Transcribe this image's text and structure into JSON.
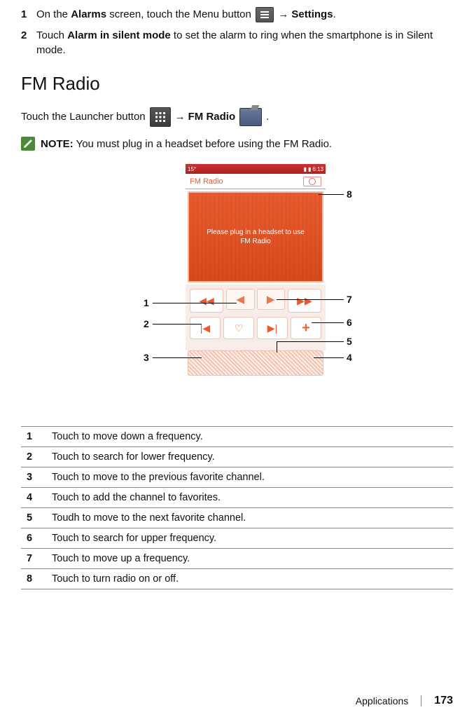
{
  "steps_top": [
    {
      "num": "1",
      "parts": [
        "On the ",
        {
          "b": "Alarms"
        },
        " screen, touch the Menu button ",
        {
          "icon": "menu"
        },
        " → ",
        {
          "b": "Settings"
        },
        "."
      ]
    },
    {
      "num": "2",
      "parts": [
        "Touch ",
        {
          "b": "Alarm in silent mode"
        },
        " to set the alarm to ring when the smartphone is in Silent mode."
      ]
    }
  ],
  "section_title": "FM Radio",
  "launch_line": [
    "Touch the Launcher button ",
    {
      "icon": "launcher"
    },
    " → ",
    {
      "b": "FM Radio"
    },
    " ",
    {
      "icon": "fmradio"
    },
    " ."
  ],
  "note_label": "NOTE:",
  "note_text": " You must plug in a headset before using the FM Radio.",
  "phone": {
    "status_left": "15°",
    "status_right": "6:13",
    "app_title": "FM Radio",
    "display_text": "Please plug in a headset to use FM Radio"
  },
  "callouts": {
    "l1": "1",
    "l2": "2",
    "l3": "3",
    "r4": "4",
    "r5": "5",
    "r6": "6",
    "r7": "7",
    "r8": "8"
  },
  "table": [
    {
      "num": "1",
      "desc": "Touch to move down a frequency."
    },
    {
      "num": "2",
      "desc": "Touch to search for lower frequency."
    },
    {
      "num": "3",
      "desc": "Touch to move to the previous favorite channel."
    },
    {
      "num": "4",
      "desc": "Touch to add the channel to favorites."
    },
    {
      "num": "5",
      "desc": "Toudh to move to the next favorite channel."
    },
    {
      "num": "6",
      "desc": "Touch to search for upper frequency."
    },
    {
      "num": "7",
      "desc": "Touch to move up a frequency."
    },
    {
      "num": "8",
      "desc": "Touch to turn radio on or off."
    }
  ],
  "footer": {
    "section": "Applications",
    "page": "173"
  }
}
